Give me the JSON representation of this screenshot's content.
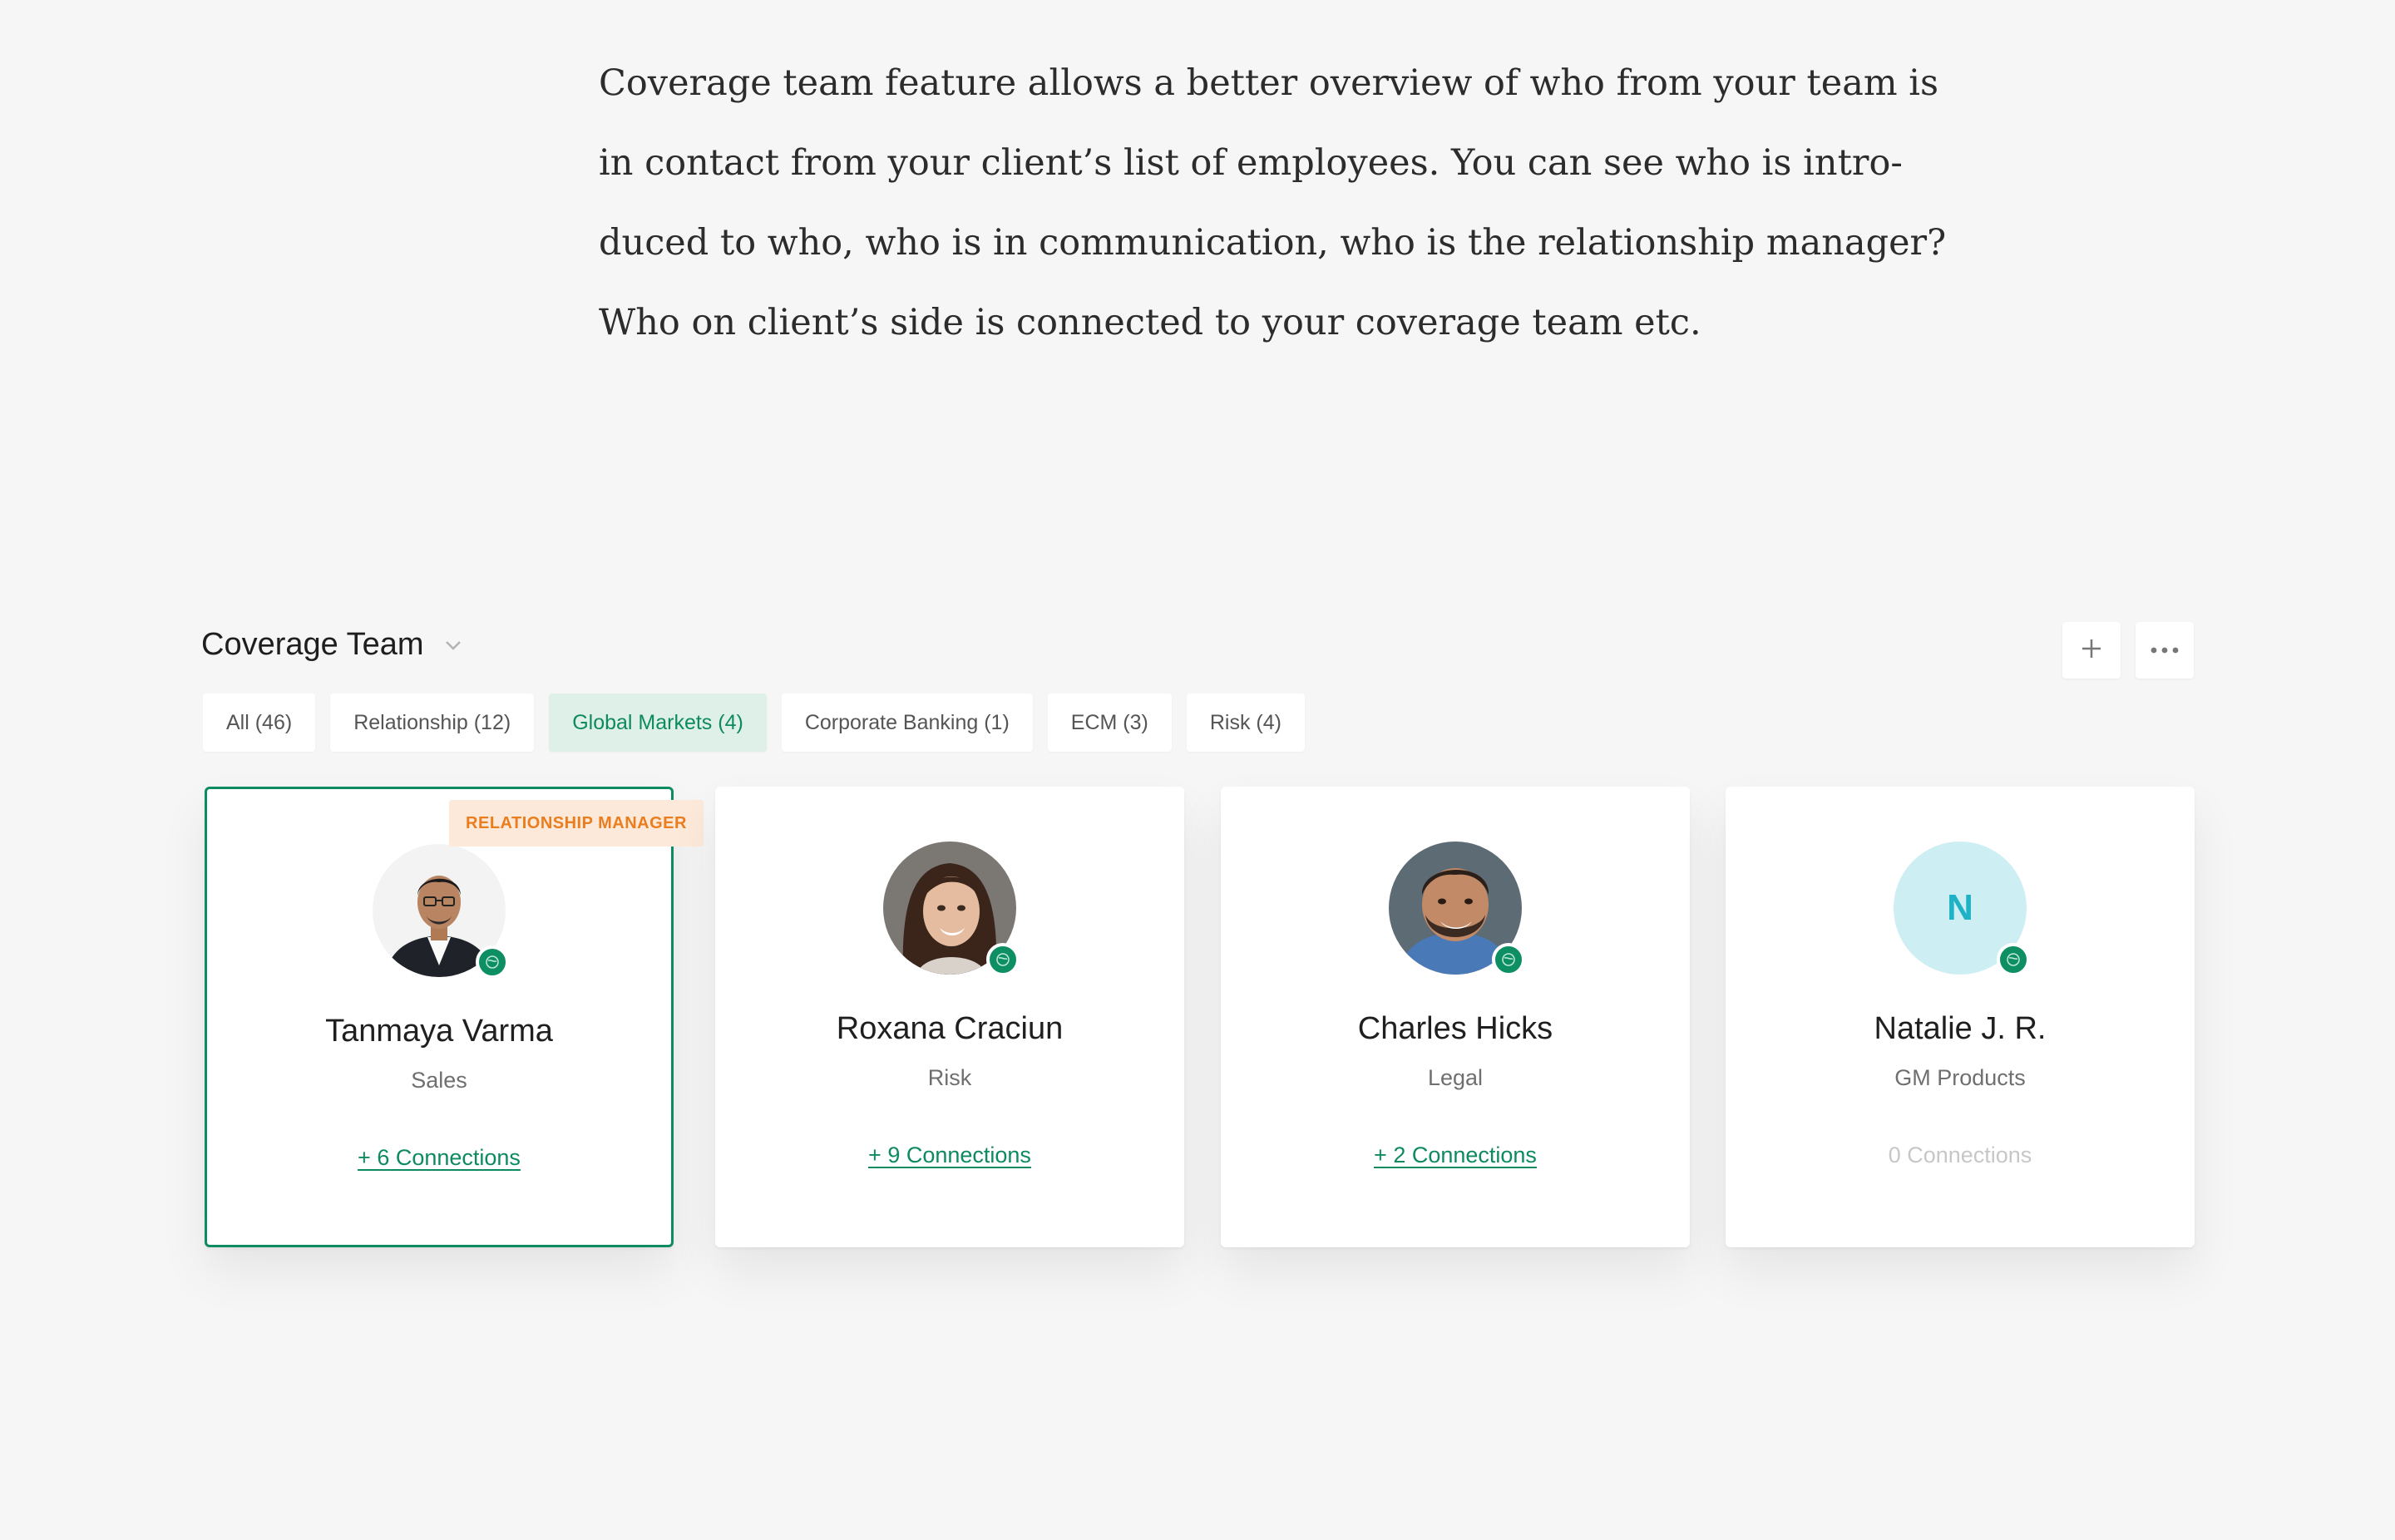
{
  "intro": {
    "lines": [
      "Coverage team feature allows a better overview of who from your team is",
      "in contact from your client’s list of employees. You can see who is intro-",
      "duced to who, who is in communication, who is the relationship manager?",
      "Who on client’s side is connected to your coverage team etc."
    ]
  },
  "header": {
    "title": "Coverage Team",
    "icons": [
      "chevron-down-icon",
      "plus-icon",
      "more-horizontal-icon"
    ]
  },
  "tabs": [
    {
      "label": "All (46)",
      "active": false
    },
    {
      "label": "Relationship (12)",
      "active": false
    },
    {
      "label": "Global Markets (4)",
      "active": true
    },
    {
      "label": "Corporate Banking (1)",
      "active": false
    },
    {
      "label": "ECM (3)",
      "active": false
    },
    {
      "label": "Risk (4)",
      "active": false
    }
  ],
  "badge": "RELATIONSHIP MANAGER",
  "people": [
    {
      "name": "Tanmaya Varma",
      "role": "Sales",
      "connections": "+ 6 Connections",
      "selected": true
    },
    {
      "name": "Roxana Craciun",
      "role": "Risk",
      "connections": "+ 9 Connections",
      "selected": false
    },
    {
      "name": "Charles Hicks",
      "role": "Legal",
      "connections": "+ 2 Connections",
      "selected": false
    },
    {
      "name": "Natalie J. R.",
      "role": "GM Products",
      "connections": "0 Connections",
      "initial": "N",
      "selected": false
    }
  ],
  "colors": {
    "accent": "#0d8a5f",
    "badge_bg": "#fde9d9",
    "badge_text": "#ea7d1d",
    "avatar_initial_bg": "#cdeef2",
    "avatar_initial_text": "#1fb2c7"
  }
}
